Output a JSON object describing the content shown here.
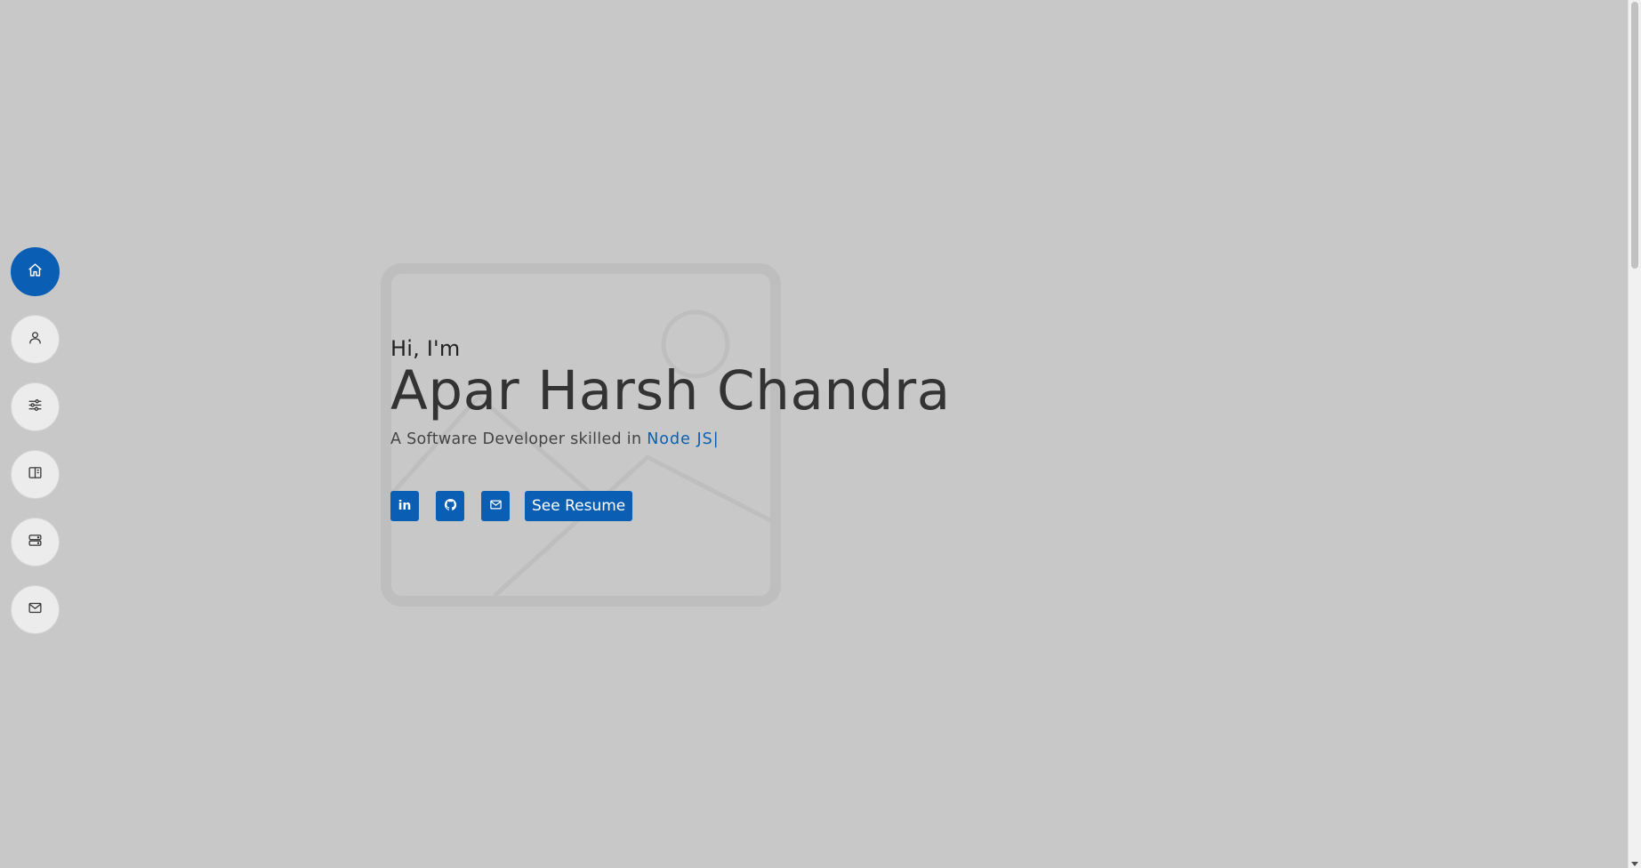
{
  "sidebar": {
    "items": [
      {
        "id": "home",
        "icon": "home-icon",
        "active": true
      },
      {
        "id": "about",
        "icon": "user-icon",
        "active": false
      },
      {
        "id": "skills",
        "icon": "sliders-icon",
        "active": false
      },
      {
        "id": "projects",
        "icon": "book-icon",
        "active": false
      },
      {
        "id": "experience",
        "icon": "server-icon",
        "active": false
      },
      {
        "id": "contact",
        "icon": "mail-icon",
        "active": false
      }
    ]
  },
  "hero": {
    "greeting": "Hi, I'm",
    "name": "Apar Harsh Chandra",
    "tagline_prefix": "A Software Developer skilled in ",
    "skill": "Node JS|",
    "social": [
      {
        "icon": "linkedin-icon",
        "label": "in"
      },
      {
        "icon": "github-icon"
      },
      {
        "icon": "mail-icon"
      }
    ],
    "resume_label": "See Resume"
  },
  "colors": {
    "background": "#c8c8c8",
    "accent": "#0a5fb4",
    "nav_inactive": "#ececec",
    "text_dark": "#333333"
  }
}
